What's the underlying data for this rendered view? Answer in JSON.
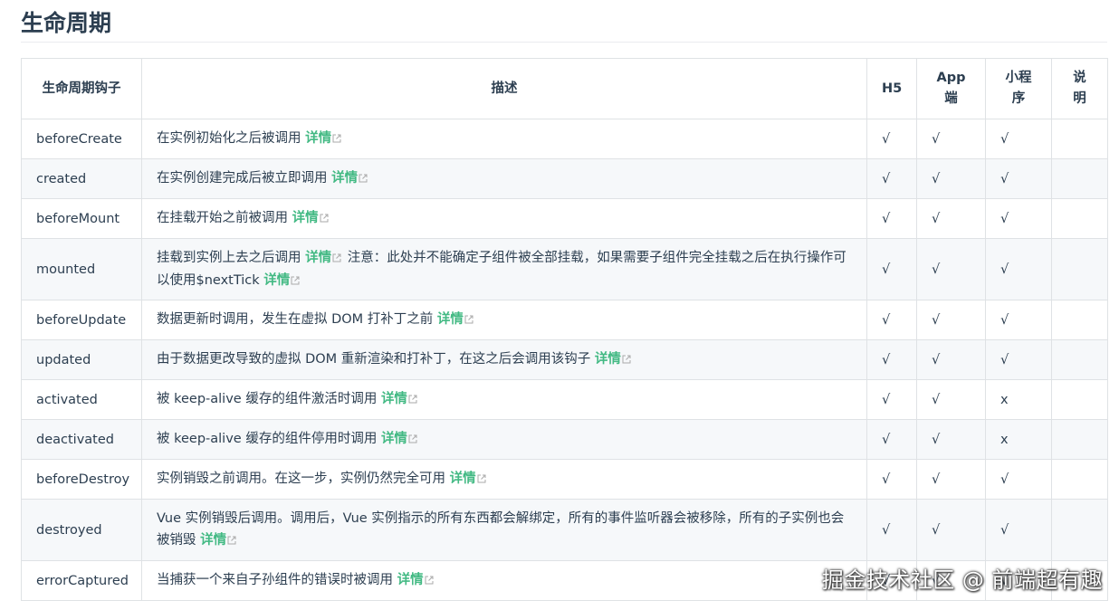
{
  "title": "生命周期",
  "headers": {
    "hook": "生命周期钩子",
    "desc": "描述",
    "h5": "H5",
    "app": "App端",
    "mini": "小程序",
    "note": "说明"
  },
  "link_text": "详情",
  "colors": {
    "link": "#42b983",
    "text": "#2c3e50",
    "border": "#dfe2e5",
    "stripe": "#f6f8fa"
  },
  "rows": [
    {
      "hook": "beforeCreate",
      "desc": "在实例初始化之后被调用",
      "h5": "√",
      "app": "√",
      "mini": "√",
      "note": ""
    },
    {
      "hook": "created",
      "desc": "在实例创建完成后被立即调用",
      "h5": "√",
      "app": "√",
      "mini": "√",
      "note": ""
    },
    {
      "hook": "beforeMount",
      "desc": "在挂载开始之前被调用",
      "h5": "√",
      "app": "√",
      "mini": "√",
      "note": ""
    },
    {
      "hook": "mounted",
      "desc": "挂载到实例上去之后调用",
      "desc2": "注意：此处并不能确定子组件被全部挂载，如果需要子组件完全挂载之后在执行操作可以使用$nextTick",
      "h5": "√",
      "app": "√",
      "mini": "√",
      "note": ""
    },
    {
      "hook": "beforeUpdate",
      "desc": "数据更新时调用，发生在虚拟 DOM 打补丁之前",
      "h5": "√",
      "app": "√",
      "mini": "√",
      "note": ""
    },
    {
      "hook": "updated",
      "desc": "由于数据更改导致的虚拟 DOM 重新渲染和打补丁，在这之后会调用该钩子",
      "h5": "√",
      "app": "√",
      "mini": "√",
      "note": ""
    },
    {
      "hook": "activated",
      "desc": "被 keep-alive 缓存的组件激活时调用",
      "h5": "√",
      "app": "√",
      "mini": "x",
      "note": ""
    },
    {
      "hook": "deactivated",
      "desc": "被 keep-alive 缓存的组件停用时调用",
      "h5": "√",
      "app": "√",
      "mini": "x",
      "note": ""
    },
    {
      "hook": "beforeDestroy",
      "desc": "实例销毁之前调用。在这一步，实例仍然完全可用",
      "h5": "√",
      "app": "√",
      "mini": "√",
      "note": ""
    },
    {
      "hook": "destroyed",
      "desc": "Vue 实例销毁后调用。调用后，Vue 实例指示的所有东西都会解绑定，所有的事件监听器会被移除，所有的子实例也会被销毁",
      "h5": "√",
      "app": "√",
      "mini": "√",
      "note": ""
    },
    {
      "hook": "errorCaptured",
      "desc": "当捕获一个来自子孙组件的错误时被调用",
      "h5": "√",
      "app": "√",
      "mini": "√",
      "note": ""
    }
  ],
  "watermark": "掘金技术社区 @ 前端超有趣"
}
